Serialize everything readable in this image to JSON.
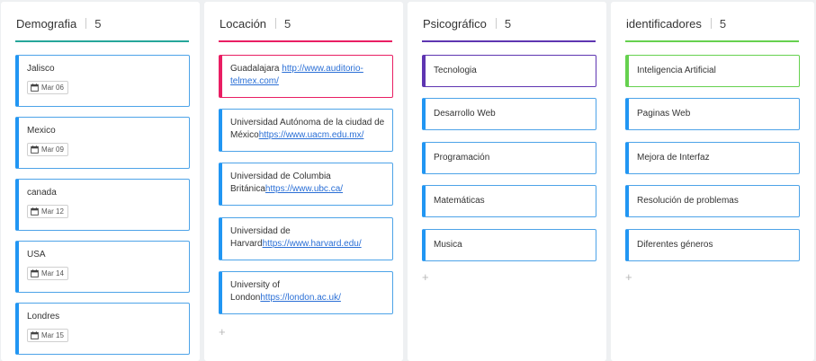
{
  "columns": [
    {
      "title": "Demografia",
      "count": "5",
      "accent": "#26a69a",
      "cards": [
        {
          "text": "Jalisco",
          "date": "Mar 06"
        },
        {
          "text": "Mexico",
          "date": "Mar 09"
        },
        {
          "text": "canada",
          "date": "Mar 12"
        },
        {
          "text": "USA",
          "date": "Mar 14"
        },
        {
          "text": "Londres",
          "date": "Mar 15"
        }
      ]
    },
    {
      "title": "Locación",
      "count": "5",
      "accent": "#e91e63",
      "cards": [
        {
          "prefix": "Guadalajara ",
          "link": "http://www.auditorio-telmex.com/"
        },
        {
          "prefix": "Universidad Autónoma de la ciudad de México",
          "link": "https://www.uacm.edu.mx/"
        },
        {
          "prefix": "Universidad de Columbia Británica",
          "link": "https://www.ubc.ca/"
        },
        {
          "prefix": "Universidad de Harvard",
          "link": "https://www.harvard.edu/"
        },
        {
          "prefix": "University of London",
          "link": "https://london.ac.uk/"
        }
      ],
      "add_label": "+"
    },
    {
      "title": "Psicográfico",
      "count": "5",
      "accent": "#5e35b1",
      "cards": [
        {
          "text": "Tecnologia"
        },
        {
          "text": "Desarrollo Web"
        },
        {
          "text": "Programación"
        },
        {
          "text": "Matemáticas"
        },
        {
          "text": "Musica"
        }
      ],
      "add_label": "+"
    },
    {
      "title": "identificadores",
      "count": "5",
      "accent": "#66d14f",
      "cards": [
        {
          "text": "Inteligencia Artificial"
        },
        {
          "text": "Paginas Web"
        },
        {
          "text": "Mejora de Interfaz"
        },
        {
          "text": "Resolución de problemas"
        },
        {
          "text": "Diferentes géneros"
        }
      ],
      "add_label": "+"
    }
  ]
}
